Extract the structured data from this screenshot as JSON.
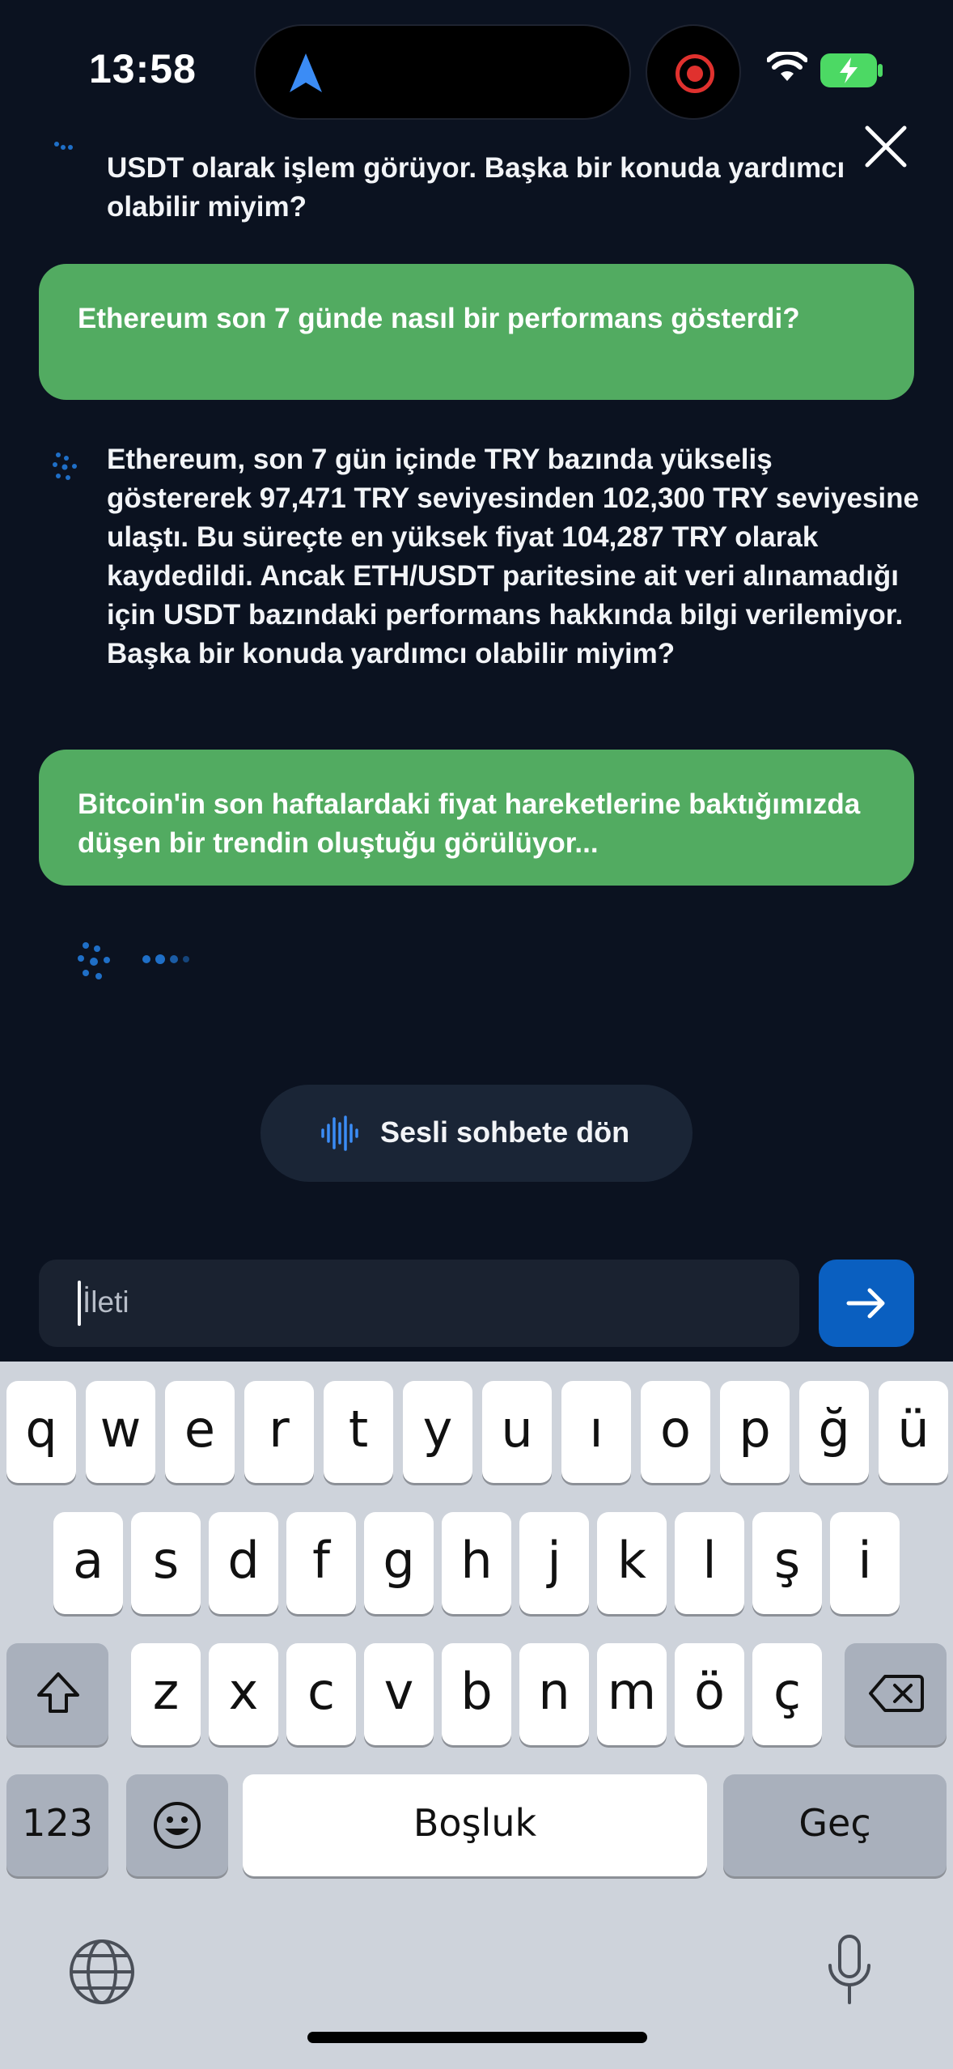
{
  "status_bar": {
    "time": "13:58"
  },
  "chat": {
    "messages": [
      {
        "role": "assistant",
        "text": "USDT olarak işlem görüyor. Başka bir konuda yardımcı olabilir miyim?"
      },
      {
        "role": "user",
        "text": "Ethereum son 7 günde nasıl bir performans gösterdi?"
      },
      {
        "role": "assistant",
        "text": "Ethereum, son 7 gün içinde TRY bazında yükseliş göstererek 97,471 TRY seviyesinden 102,300 TRY seviyesine ulaştı. Bu süreçte en yüksek fiyat 104,287 TRY olarak kaydedildi. Ancak ETH/USDT paritesine ait veri alınamadığı için USDT bazındaki performans hakkında bilgi verilemiyor. Başka bir konuda yardımcı olabilir miyim?"
      },
      {
        "role": "user",
        "text": "Bitcoin'in son haftalardaki fiyat hareketlerine baktığımızda düşen bir trendin oluştuğu görülüyor..."
      }
    ]
  },
  "voice_button": {
    "label": "Sesli sohbete dön",
    "icon": "waveform-icon"
  },
  "composer": {
    "placeholder": "İleti",
    "send_icon": "arrow-right-icon"
  },
  "keyboard": {
    "row1": [
      "q",
      "w",
      "e",
      "r",
      "t",
      "y",
      "u",
      "ı",
      "o",
      "p",
      "ğ",
      "ü"
    ],
    "row2": [
      "a",
      "s",
      "d",
      "f",
      "g",
      "h",
      "j",
      "k",
      "l",
      "ş",
      "i"
    ],
    "row3": [
      "z",
      "x",
      "c",
      "v",
      "b",
      "n",
      "m",
      "ö",
      "ç"
    ],
    "numbers_label": "123",
    "space_label": "Boşluk",
    "return_label": "Geç"
  },
  "colors": {
    "background": "#0b1220",
    "user_bubble": "#52ab61",
    "send_button": "#0a5fc0",
    "accent": "#1f6fc7"
  }
}
